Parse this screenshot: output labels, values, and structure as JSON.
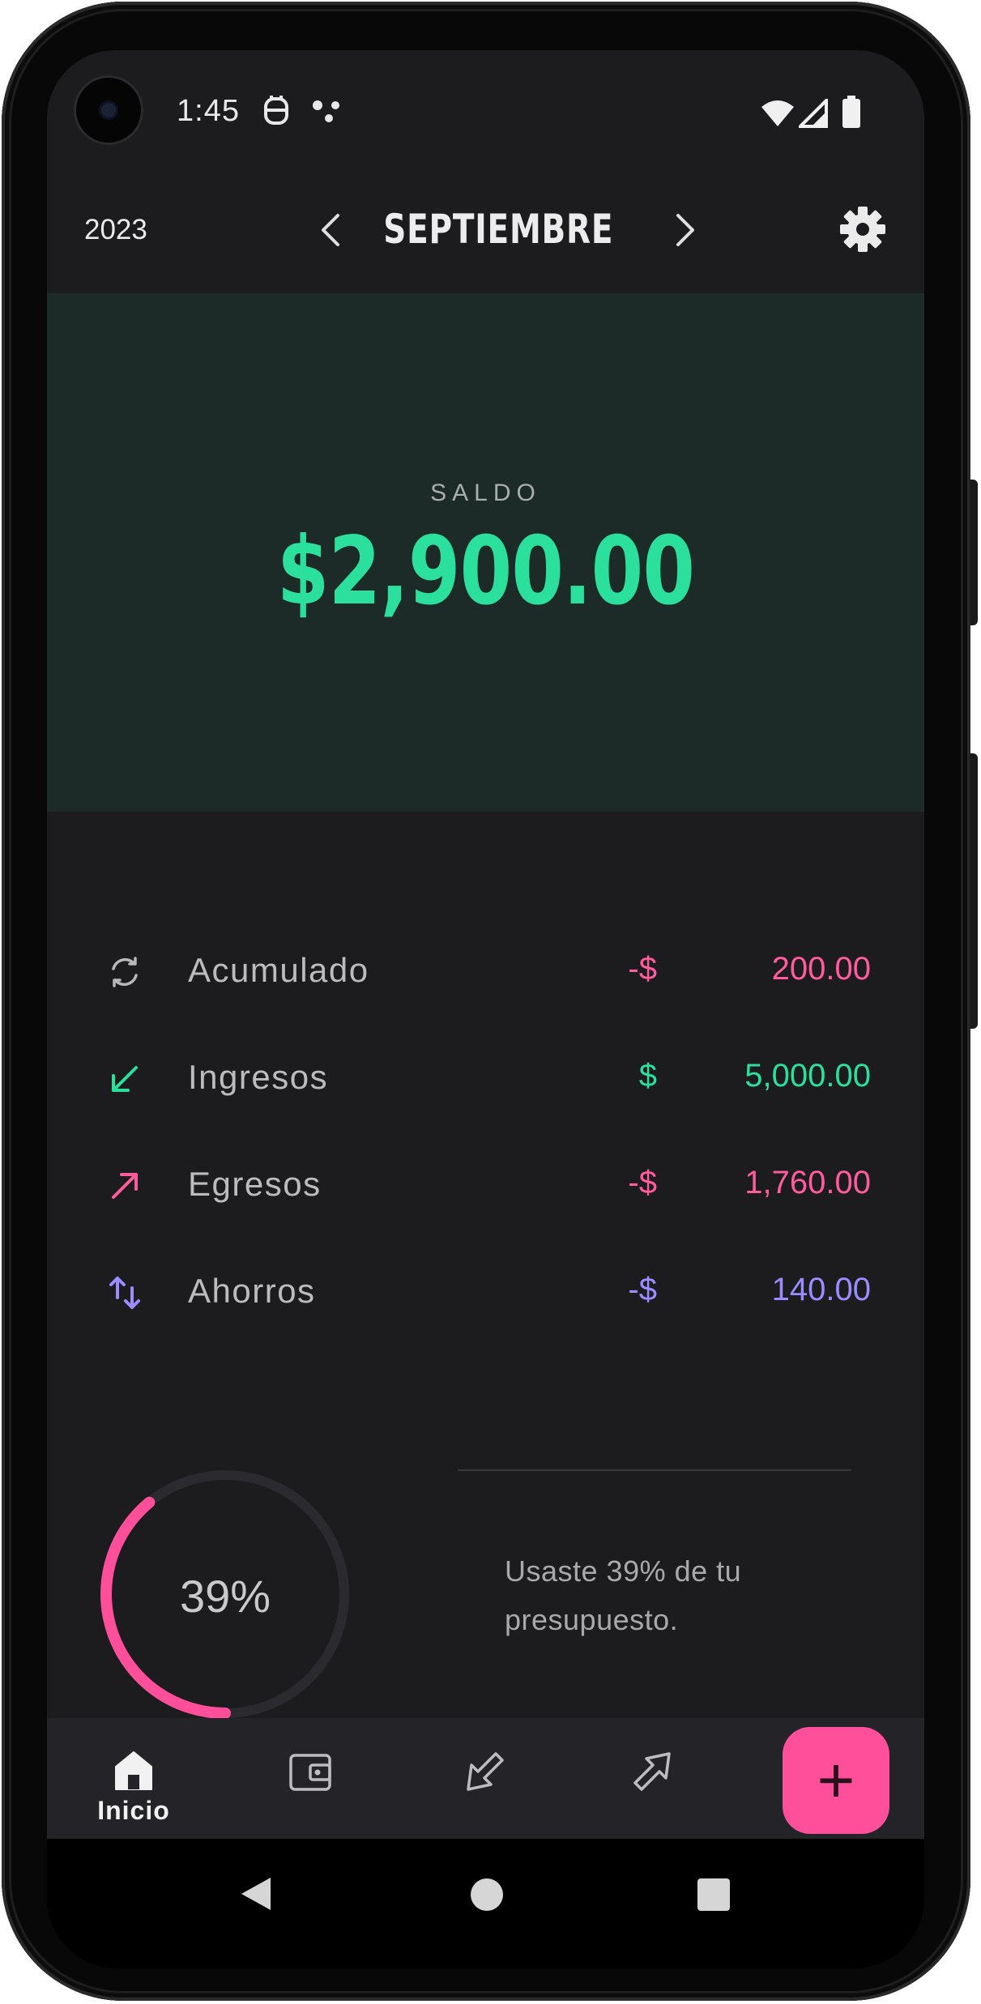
{
  "status_bar": {
    "time": "1:45"
  },
  "header": {
    "year": "2023",
    "month": "SEPTIEMBRE"
  },
  "balance": {
    "label": "SALDO",
    "value": "$2,900.00"
  },
  "summary": [
    {
      "label": "Acumulado",
      "currency": "-$",
      "amount": "200.00",
      "color": "#ff5c9e",
      "icon": "refresh-icon"
    },
    {
      "label": "Ingresos",
      "currency": "$",
      "amount": "5,000.00",
      "color": "#2bdf9c",
      "icon": "arrow-down-left-icon"
    },
    {
      "label": "Egresos",
      "currency": "-$",
      "amount": "1,760.00",
      "color": "#ff5c9e",
      "icon": "arrow-up-right-icon"
    },
    {
      "label": "Ahorros",
      "currency": "-$",
      "amount": "140.00",
      "color": "#9b8cff",
      "icon": "swap-vertical-icon"
    }
  ],
  "budget": {
    "percent_label": "39%",
    "percent": 0.39,
    "message": "Usaste 39% de tu presupuesto."
  },
  "bottom_nav": {
    "items": [
      {
        "label": "Inicio",
        "icon": "home-icon",
        "active": true
      },
      {
        "label": "",
        "icon": "wallet-icon",
        "active": false
      },
      {
        "label": "",
        "icon": "income-tag-icon",
        "active": false
      },
      {
        "label": "",
        "icon": "expense-tag-icon",
        "active": false
      }
    ],
    "fab_symbol": "+"
  }
}
